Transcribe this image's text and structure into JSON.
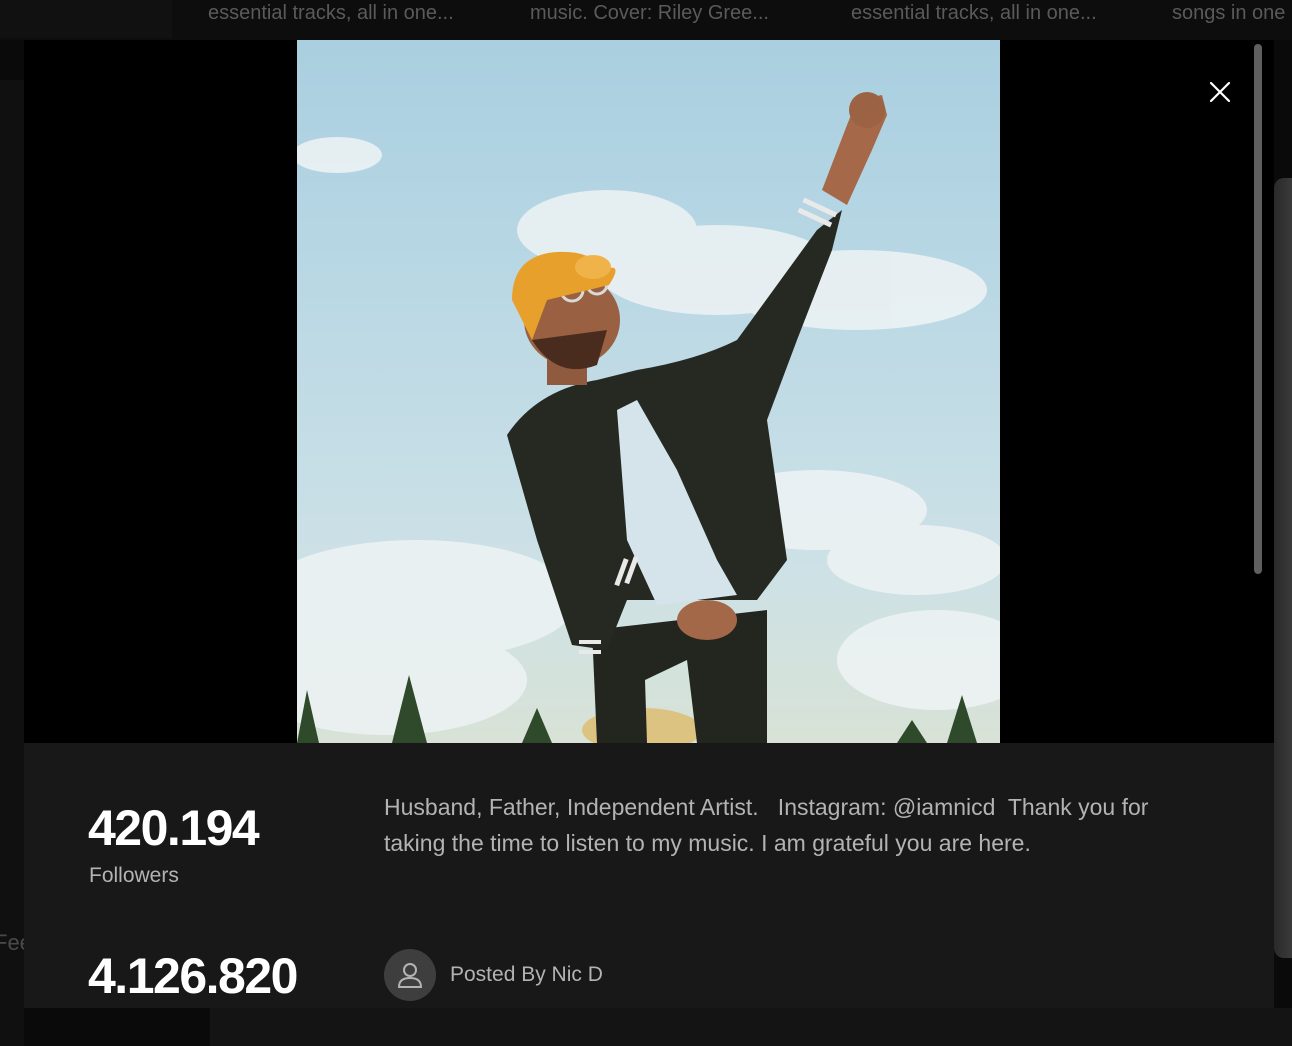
{
  "background": {
    "cards": [
      "essential tracks, all in one...",
      "music. Cover: Riley Gree...",
      "essential tracks, all in one...",
      "songs in one"
    ],
    "left_partial_word": "Fee"
  },
  "modal": {
    "photo_alt": "",
    "close_icon": "close-icon",
    "stats": [
      {
        "value": "420.194",
        "label": "Followers"
      },
      {
        "value": "4.126.820",
        "label": ""
      }
    ],
    "bio": "Husband, Father, Independent Artist.   Instagram: @iamnicd  Thank you for taking the time to listen to my music. I am grateful you are here.",
    "posted_by": "Posted By Nic D",
    "avatar_icon": "user-icon"
  },
  "colors": {
    "panel": "#181818",
    "text_primary": "#ffffff",
    "text_secondary": "#b3b3b3"
  }
}
